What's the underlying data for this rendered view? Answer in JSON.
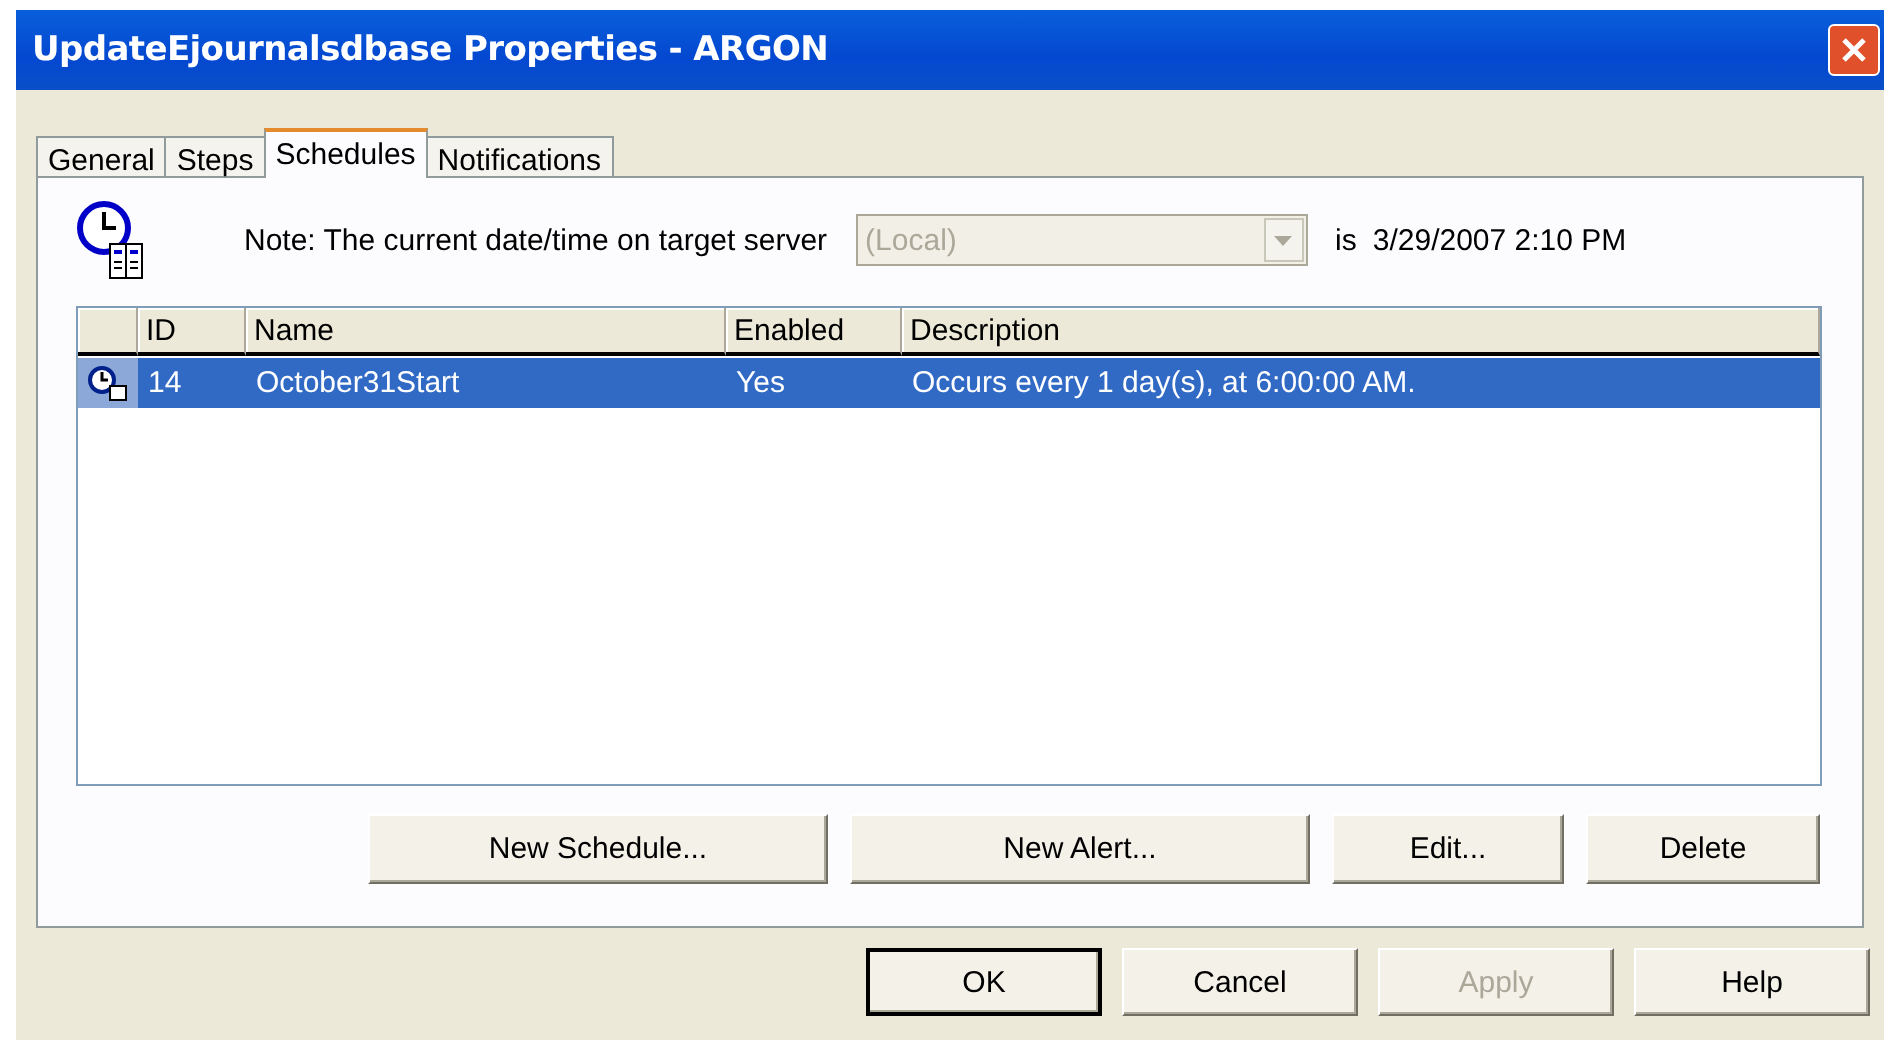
{
  "window": {
    "title": "UpdateEjournalsdbase Properties - ARGON"
  },
  "tabs": [
    {
      "label": "General",
      "selected": false
    },
    {
      "label": "Steps",
      "selected": false
    },
    {
      "label": "Schedules",
      "selected": true
    },
    {
      "label": "Notifications",
      "selected": false
    }
  ],
  "note": {
    "label": "Note: The current date/time on target server",
    "server": {
      "value": "(Local)",
      "disabled": true
    },
    "is_label": "is",
    "datetime": "3/29/2007 2:10 PM"
  },
  "schedules": {
    "columns": [
      "ID",
      "Name",
      "Enabled",
      "Description"
    ],
    "rows": [
      {
        "cells": [
          "14",
          "October31Start",
          "Yes",
          "Occurs every 1 day(s), at 6:00:00 AM."
        ],
        "selected": true
      }
    ]
  },
  "list_buttons": [
    "New Schedule...",
    "New Alert...",
    "Edit...",
    "Delete"
  ],
  "buttons": [
    {
      "label": "OK",
      "default": true,
      "disabled": false
    },
    {
      "label": "Cancel",
      "default": false,
      "disabled": false
    },
    {
      "label": "Apply",
      "default": false,
      "disabled": true
    },
    {
      "label": "Help",
      "default": false,
      "disabled": false
    }
  ]
}
